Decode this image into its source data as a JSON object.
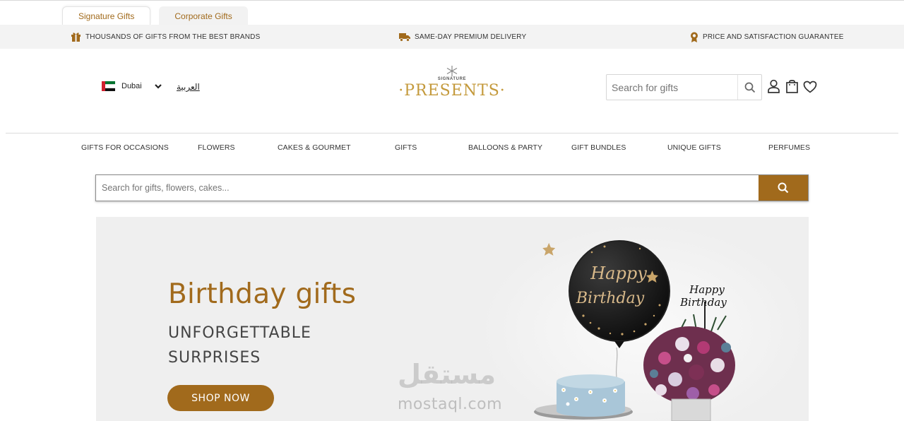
{
  "tabs": [
    {
      "label": "Signature Gifts",
      "active": true
    },
    {
      "label": "Corporate Gifts",
      "active": false
    }
  ],
  "usp_bar": {
    "items": [
      {
        "icon": "gift-icon",
        "text": "THOUSANDS OF GIFTS FROM THE BEST BRANDS"
      },
      {
        "icon": "truck-icon",
        "text": "SAME-DAY PREMIUM DELIVERY"
      },
      {
        "icon": "award-icon",
        "text": "PRICE AND SATISFACTION GUARANTEE"
      }
    ]
  },
  "header": {
    "city": "Dubai",
    "flag": "uae-flag",
    "language_link": "العربية",
    "logo_top": "SIGNATURE",
    "logo_main": "·PRESENTS·",
    "search_placeholder": "Search for gifts",
    "icons": [
      "search-icon",
      "user-icon",
      "bag-icon",
      "heart-icon"
    ]
  },
  "nav": {
    "items": [
      "GIFTS FOR OCCASIONS",
      "FLOWERS",
      "CAKES & GOURMET",
      "GIFTS",
      "BALLOONS & PARTY",
      "GIFT BUNDLES",
      "UNIQUE GIFTS",
      "PERFUMES"
    ]
  },
  "main_search": {
    "placeholder": "Search for gifts, flowers, cakes..."
  },
  "hero": {
    "title": "Birthday gifts",
    "subtitle": "UNFORGETTABLE SURPRISES",
    "cta": "SHOP NOW",
    "balloon_text_1": "Happy",
    "balloon_text_2": "Birthday",
    "topper_text_1": "Happy",
    "topper_text_2": "Birthday"
  },
  "watermark": {
    "arabic": "مستقل",
    "latin": "mostaql.com"
  },
  "colors": {
    "brand": "#a16a1c",
    "logo_gold": "#c49a3c",
    "usp_bg": "#f3f3f3",
    "hero_bg": "#efefef"
  }
}
